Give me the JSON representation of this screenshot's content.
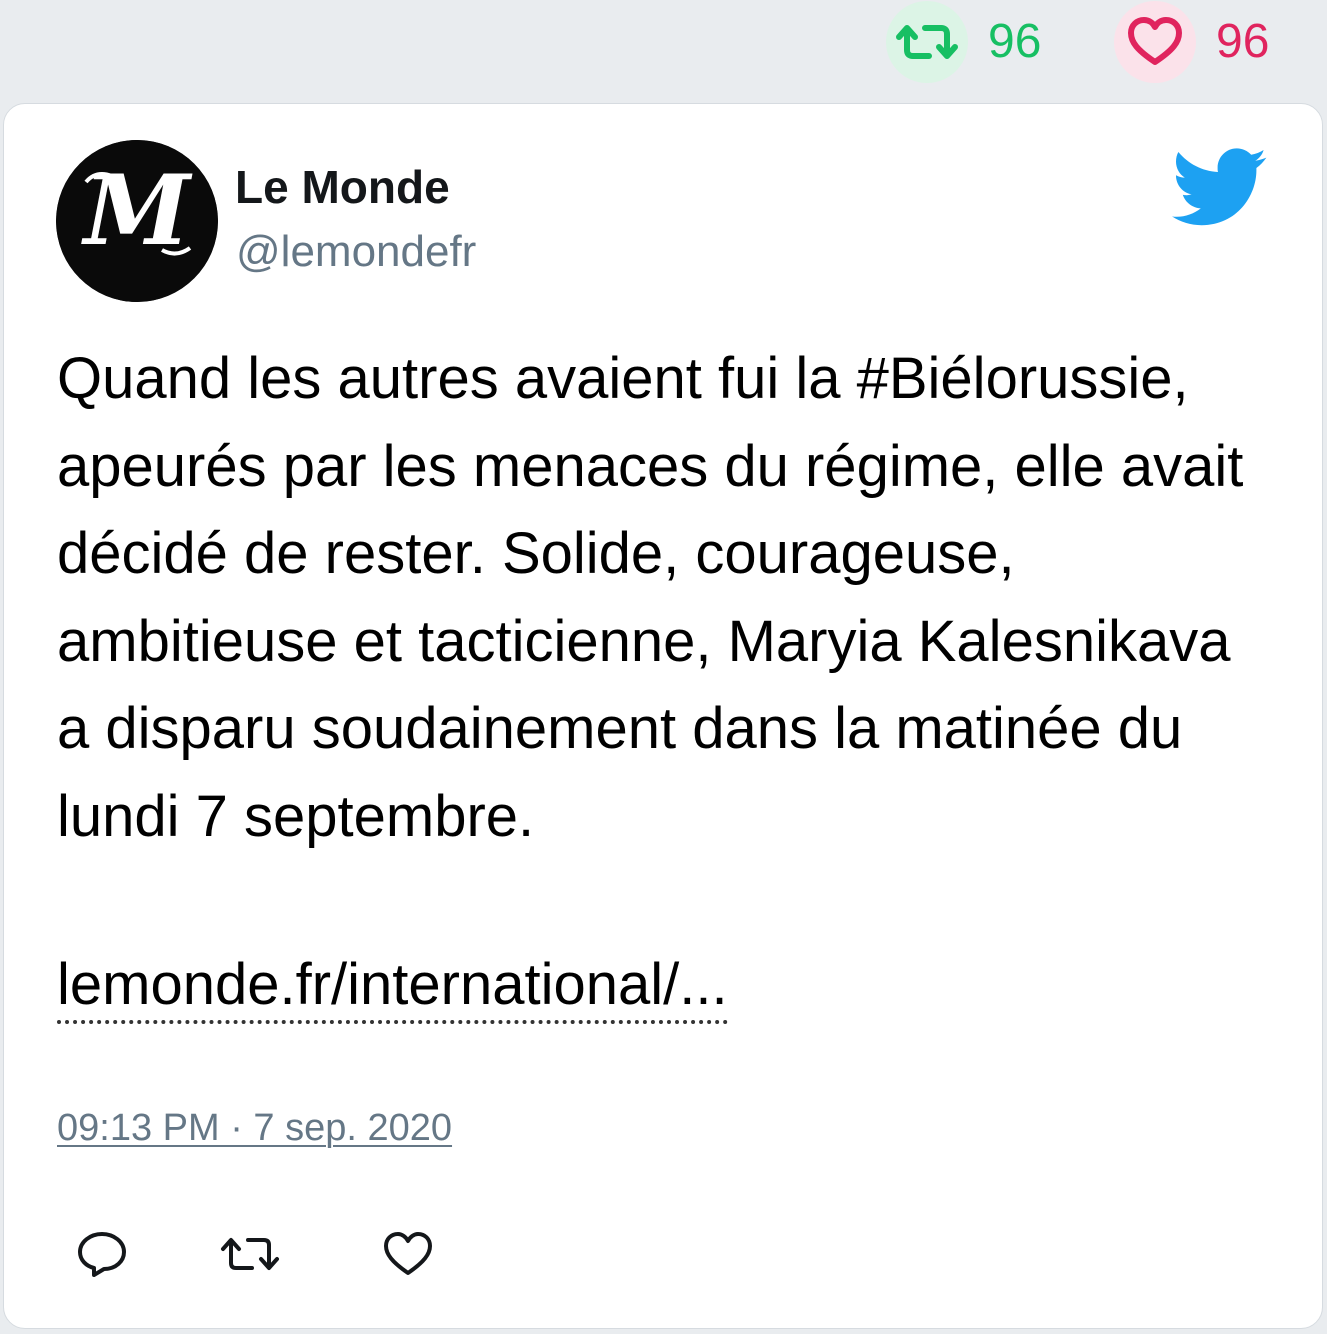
{
  "stats": {
    "retweet_count": "96",
    "like_count": "96",
    "retweet_color": "#17bf63",
    "like_color": "#e0245e"
  },
  "tweet": {
    "author_name": "Le Monde",
    "author_handle": "@lemondefr",
    "avatar_icon": "le-monde-logo",
    "platform_icon": "twitter-bird-icon",
    "text": "Quand les autres avaient fui la #Biélorussie, apeurés par les menaces du régime, elle avait décidé de rester. Solide, courageuse, ambitieuse et tacticienne, Maryia Kalesnikava a disparu soudainement dans la matinée du lundi 7 septembre.",
    "link_text": "lemonde.fr/international/...",
    "timestamp": "09:13 PM · 7 sep. 2020"
  },
  "actions": {
    "reply_icon": "reply-icon",
    "retweet_icon": "retweet-icon",
    "like_icon": "heart-icon"
  },
  "colors": {
    "page_bg": "#e9ecef",
    "card_bg": "#ffffff",
    "secondary_text": "#657786",
    "twitter_blue": "#1da1f2"
  }
}
